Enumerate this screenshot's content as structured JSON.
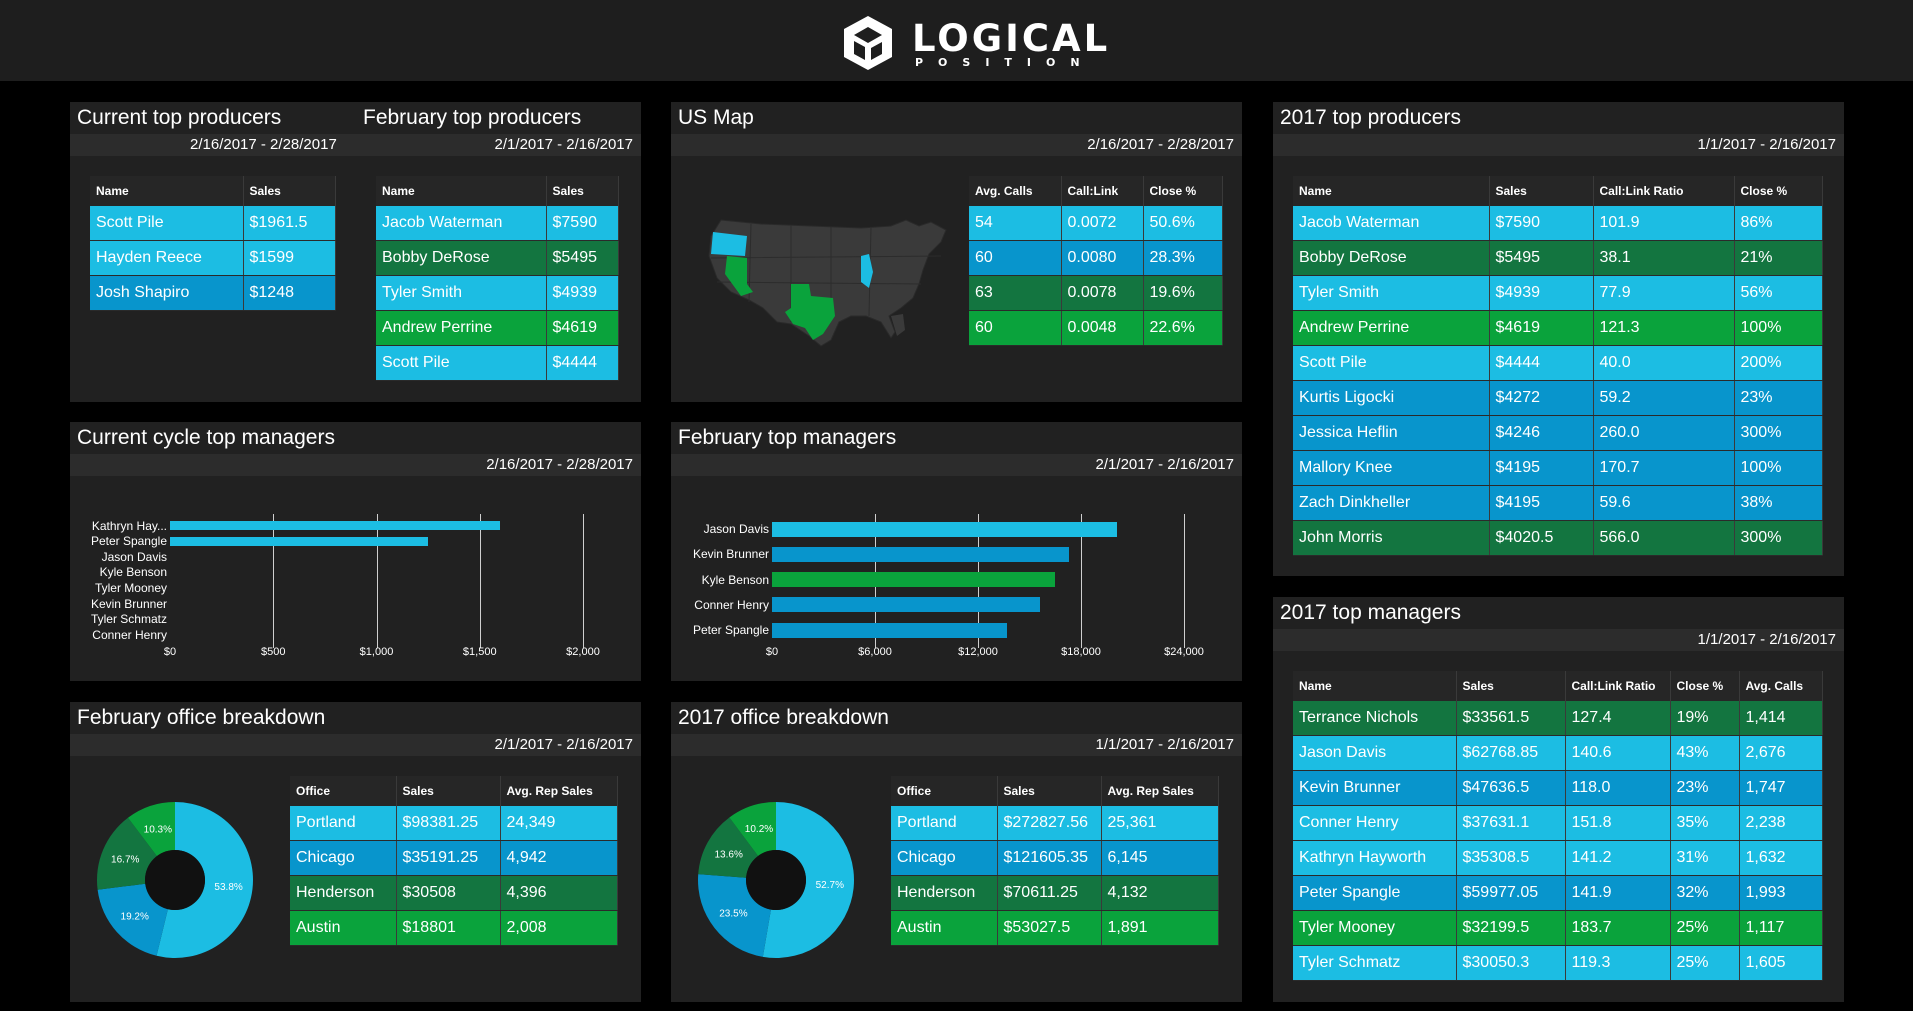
{
  "brand": {
    "name": "LOGICAL",
    "sub": "POSITION"
  },
  "colors": {
    "light": "#1cbde3",
    "mid": "#0895cc",
    "dark_green": "#137540",
    "green": "#0aa33c"
  },
  "current_top_producers": {
    "title": "Current top producers",
    "date": "2/16/2017 - 2/28/2017",
    "columns": [
      "Name",
      "Sales"
    ],
    "rows": [
      {
        "cells": [
          "Scott Pile",
          "$1961.5"
        ],
        "color": "light"
      },
      {
        "cells": [
          "Hayden Reece",
          "$1599"
        ],
        "color": "light"
      },
      {
        "cells": [
          "Josh Shapiro",
          "$1248"
        ],
        "color": "mid"
      }
    ]
  },
  "february_top_producers": {
    "title": "February top producers",
    "date": "2/1/2017 - 2/16/2017",
    "columns": [
      "Name",
      "Sales"
    ],
    "rows": [
      {
        "cells": [
          "Jacob Waterman",
          "$7590"
        ],
        "color": "light"
      },
      {
        "cells": [
          "Bobby DeRose",
          "$5495"
        ],
        "color": "dark_green"
      },
      {
        "cells": [
          "Tyler Smith",
          "$4939"
        ],
        "color": "light"
      },
      {
        "cells": [
          "Andrew Perrine",
          "$4619"
        ],
        "color": "green"
      },
      {
        "cells": [
          "Scott Pile",
          "$4444"
        ],
        "color": "light"
      }
    ]
  },
  "us_map": {
    "title": "US Map",
    "date": "2/16/2017 - 2/28/2017",
    "columns": [
      "Avg. Calls",
      "Call:Link",
      "Close %"
    ],
    "rows": [
      {
        "cells": [
          "54",
          "0.0072",
          "50.6%"
        ],
        "color": "light"
      },
      {
        "cells": [
          "60",
          "0.0080",
          "28.3%"
        ],
        "color": "mid"
      },
      {
        "cells": [
          "63",
          "0.0078",
          "19.6%"
        ],
        "color": "dark_green"
      },
      {
        "cells": [
          "60",
          "0.0048",
          "22.6%"
        ],
        "color": "green"
      }
    ]
  },
  "top_producers_2017": {
    "title": "2017 top producers",
    "date": "1/1/2017 - 2/16/2017",
    "columns": [
      "Name",
      "Sales",
      "Call:Link Ratio",
      "Close %"
    ],
    "rows": [
      {
        "cells": [
          "Jacob Waterman",
          "$7590",
          "101.9",
          "86%"
        ],
        "color": "light"
      },
      {
        "cells": [
          "Bobby DeRose",
          "$5495",
          "38.1",
          "21%"
        ],
        "color": "dark_green"
      },
      {
        "cells": [
          "Tyler Smith",
          "$4939",
          "77.9",
          "56%"
        ],
        "color": "light"
      },
      {
        "cells": [
          "Andrew Perrine",
          "$4619",
          "121.3",
          "100%"
        ],
        "color": "green"
      },
      {
        "cells": [
          "Scott Pile",
          "$4444",
          "40.0",
          "200%"
        ],
        "color": "light"
      },
      {
        "cells": [
          "Kurtis Ligocki",
          "$4272",
          "59.2",
          "23%"
        ],
        "color": "mid"
      },
      {
        "cells": [
          "Jessica Heflin",
          "$4246",
          "260.0",
          "300%"
        ],
        "color": "mid"
      },
      {
        "cells": [
          "Mallory Knee",
          "$4195",
          "170.7",
          "100%"
        ],
        "color": "mid"
      },
      {
        "cells": [
          "Zach Dinkheller",
          "$4195",
          "59.6",
          "38%"
        ],
        "color": "mid"
      },
      {
        "cells": [
          "John Morris",
          "$4020.5",
          "566.0",
          "300%"
        ],
        "color": "dark_green"
      }
    ]
  },
  "managers_2017": {
    "title": "2017 top managers",
    "date": "1/1/2017 - 2/16/2017",
    "columns": [
      "Name",
      "Sales",
      "Call:Link Ratio",
      "Close %",
      "Avg. Calls"
    ],
    "rows": [
      {
        "cells": [
          "Terrance Nichols",
          "$33561.5",
          "127.4",
          "19%",
          "1,414"
        ],
        "color": "dark_green"
      },
      {
        "cells": [
          "Jason Davis",
          "$62768.85",
          "140.6",
          "43%",
          "2,676"
        ],
        "color": "light"
      },
      {
        "cells": [
          "Kevin Brunner",
          "$47636.5",
          "118.0",
          "23%",
          "1,747"
        ],
        "color": "mid"
      },
      {
        "cells": [
          "Conner Henry",
          "$37631.1",
          "151.8",
          "35%",
          "2,238"
        ],
        "color": "light"
      },
      {
        "cells": [
          "Kathryn Hayworth",
          "$35308.5",
          "141.2",
          "31%",
          "1,632"
        ],
        "color": "light"
      },
      {
        "cells": [
          "Peter Spangle",
          "$59977.05",
          "141.9",
          "32%",
          "1,993"
        ],
        "color": "mid"
      },
      {
        "cells": [
          "Tyler Mooney",
          "$32199.5",
          "183.7",
          "25%",
          "1,117"
        ],
        "color": "green"
      },
      {
        "cells": [
          "Tyler Schmatz",
          "$30050.3",
          "119.3",
          "25%",
          "1,605"
        ],
        "color": "light"
      }
    ]
  },
  "feb_office": {
    "title": "February office breakdown",
    "date": "2/1/2017 - 2/16/2017",
    "columns": [
      "Office",
      "Sales",
      "Avg. Rep Sales"
    ],
    "rows": [
      {
        "cells": [
          "Portland",
          "$98381.25",
          "24,349"
        ],
        "color": "light"
      },
      {
        "cells": [
          "Chicago",
          "$35191.25",
          "4,942"
        ],
        "color": "mid"
      },
      {
        "cells": [
          "Henderson",
          "$30508",
          "4,396"
        ],
        "color": "dark_green"
      },
      {
        "cells": [
          "Austin",
          "$18801",
          "2,008"
        ],
        "color": "green"
      }
    ]
  },
  "office_2017": {
    "title": "2017 office breakdown",
    "date": "1/1/2017 - 2/16/2017",
    "columns": [
      "Office",
      "Sales",
      "Avg. Rep Sales"
    ],
    "rows": [
      {
        "cells": [
          "Portland",
          "$272827.56",
          "25,361"
        ],
        "color": "light"
      },
      {
        "cells": [
          "Chicago",
          "$121605.35",
          "6,145"
        ],
        "color": "mid"
      },
      {
        "cells": [
          "Henderson",
          "$70611.25",
          "4,132"
        ],
        "color": "dark_green"
      },
      {
        "cells": [
          "Austin",
          "$53027.5",
          "1,891"
        ],
        "color": "green"
      }
    ]
  },
  "cycle_managers": {
    "title": "Current cycle top managers",
    "date": "2/16/2017 - 2/28/2017"
  },
  "feb_managers": {
    "title": "February top managers",
    "date": "2/1/2017 - 2/16/2017"
  },
  "chart_data": [
    {
      "type": "bar",
      "orientation": "horizontal",
      "categories": [
        "Kathryn Hay...",
        "Peter Spangle",
        "Jason Davis",
        "Kyle Benson",
        "Tyler Mooney",
        "Kevin Brunner",
        "Tyler Schmatz",
        "Conner Henry"
      ],
      "values": [
        1600,
        1250,
        0,
        0,
        0,
        0,
        0,
        0
      ],
      "colors": [
        "light",
        "light",
        "light",
        "light",
        "light",
        "light",
        "light",
        "light"
      ],
      "xlim": [
        0,
        2000
      ],
      "ticks": [
        0,
        500,
        1000,
        1500,
        2000
      ],
      "tick_labels": [
        "$0",
        "$500",
        "$1,000",
        "$1,500",
        "$2,000"
      ],
      "grid": true
    },
    {
      "type": "bar",
      "orientation": "horizontal",
      "categories": [
        "Jason Davis",
        "Kevin Brunner",
        "Kyle Benson",
        "Conner Henry",
        "Peter Spangle"
      ],
      "values": [
        20100,
        17300,
        16500,
        15600,
        13700
      ],
      "colors": [
        "light",
        "mid",
        "green",
        "mid",
        "mid"
      ],
      "xlim": [
        0,
        24000
      ],
      "ticks": [
        0,
        6000,
        12000,
        18000,
        24000
      ],
      "tick_labels": [
        "$0",
        "$6,000",
        "$12,000",
        "$18,000",
        "$24,000"
      ],
      "grid": true
    },
    {
      "type": "pie",
      "donut": true,
      "categories": [
        "Portland",
        "Chicago",
        "Henderson",
        "Austin"
      ],
      "values": [
        53.8,
        19.2,
        16.7,
        10.3
      ],
      "labels": [
        "53.8%",
        "19.2%",
        "16.7%",
        "10.3%"
      ],
      "colors": [
        "light",
        "mid",
        "dark_green",
        "green"
      ]
    },
    {
      "type": "pie",
      "donut": true,
      "categories": [
        "Portland",
        "Chicago",
        "Henderson",
        "Austin"
      ],
      "values": [
        52.7,
        23.5,
        13.6,
        10.2
      ],
      "labels": [
        "52.7%",
        "23.5%",
        "13.6%",
        "10.2%"
      ],
      "colors": [
        "light",
        "mid",
        "dark_green",
        "green"
      ]
    }
  ]
}
